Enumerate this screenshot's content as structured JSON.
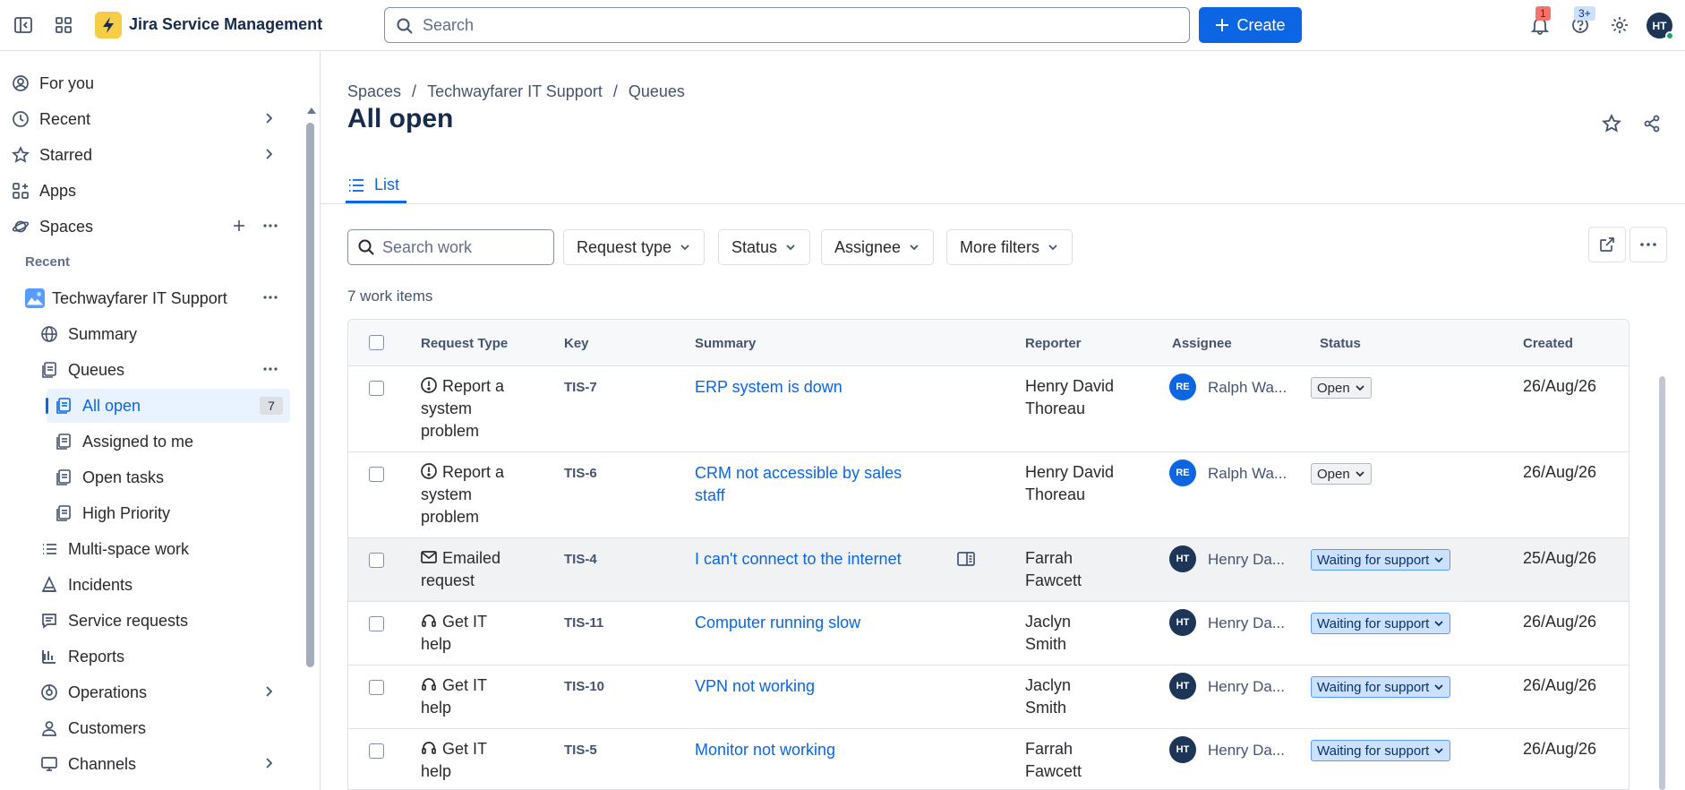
{
  "app": {
    "name": "Jira Service Management"
  },
  "topbar": {
    "search_placeholder": "Search",
    "create_label": "Create",
    "notifications_badge": "1",
    "help_badge": "3+",
    "user_initials": "HT"
  },
  "sidebar": {
    "items": [
      {
        "label": "For you",
        "icon": "user-circle-icon"
      },
      {
        "label": "Recent",
        "icon": "clock-icon"
      },
      {
        "label": "Starred",
        "icon": "star-icon"
      },
      {
        "label": "Apps",
        "icon": "apps-icon"
      },
      {
        "label": "Spaces",
        "icon": "planet-icon"
      }
    ],
    "recent_label": "Recent",
    "space": {
      "name": "Techwayfarer IT Support",
      "items": [
        {
          "label": "Summary",
          "icon": "globe-icon"
        },
        {
          "label": "Queues",
          "icon": "queue-icon"
        }
      ],
      "queues": [
        {
          "label": "All open",
          "count": "7"
        },
        {
          "label": "Assigned to me"
        },
        {
          "label": "Open tasks"
        },
        {
          "label": "High Priority"
        }
      ],
      "more": [
        {
          "label": "Multi-space work",
          "icon": "list-icon"
        },
        {
          "label": "Incidents",
          "icon": "incident-icon"
        },
        {
          "label": "Service requests",
          "icon": "request-icon"
        },
        {
          "label": "Reports",
          "icon": "chart-icon"
        },
        {
          "label": "Operations",
          "icon": "operations-icon"
        },
        {
          "label": "Customers",
          "icon": "person-icon"
        },
        {
          "label": "Channels",
          "icon": "monitor-icon"
        }
      ]
    }
  },
  "breadcrumb": [
    "Spaces",
    "Techwayfarer IT Support",
    "Queues"
  ],
  "page_title": "All open",
  "tab": {
    "label": "List"
  },
  "filters": {
    "search_placeholder": "Search work",
    "request_type": "Request type",
    "status": "Status",
    "assignee": "Assignee",
    "more": "More filters"
  },
  "work_count": "7 work items",
  "table": {
    "headers": [
      "Request Type",
      "Key",
      "Summary",
      "Reporter",
      "Assignee",
      "Status",
      "Created"
    ],
    "rows": [
      {
        "rt1": "Report a",
        "rt2": "system",
        "rt3": "problem",
        "rt_icon": "alert-icon",
        "key": "TIS-7",
        "sum1": "ERP system is down",
        "sum2": "",
        "rep1": "Henry David",
        "rep2": "Thoreau",
        "av": "RE",
        "assignee": "Ralph Wa...",
        "status": "Open",
        "created": "26/Aug/26"
      },
      {
        "rt1": "Report a",
        "rt2": "system",
        "rt3": "problem",
        "rt_icon": "alert-icon",
        "key": "TIS-6",
        "sum1": "CRM not accessible by sales",
        "sum2": "staff",
        "rep1": "Henry David",
        "rep2": "Thoreau",
        "av": "RE",
        "assignee": "Ralph Wa...",
        "status": "Open",
        "created": "26/Aug/26"
      },
      {
        "rt1": "Emailed",
        "rt2": "request",
        "rt3": "",
        "rt_icon": "mail-icon",
        "key": "TIS-4",
        "sum1": "I can't connect to the internet",
        "sum2": "",
        "rep1": "Farrah",
        "rep2": "Fawcett",
        "av": "HT",
        "assignee": "Henry Da...",
        "status": "Waiting for support",
        "created": "25/Aug/26"
      },
      {
        "rt1": "Get IT",
        "rt2": "help",
        "rt3": "",
        "rt_icon": "headset-icon",
        "key": "TIS-11",
        "sum1": "Computer running slow",
        "sum2": "",
        "rep1": "Jaclyn",
        "rep2": "Smith",
        "av": "HT",
        "assignee": "Henry Da...",
        "status": "Waiting for support",
        "created": "26/Aug/26"
      },
      {
        "rt1": "Get IT",
        "rt2": "help",
        "rt3": "",
        "rt_icon": "headset-icon",
        "key": "TIS-10",
        "sum1": "VPN not working",
        "sum2": "",
        "rep1": "Jaclyn",
        "rep2": "Smith",
        "av": "HT",
        "assignee": "Henry Da...",
        "status": "Waiting for support",
        "created": "26/Aug/26"
      },
      {
        "rt1": "Get IT",
        "rt2": "help",
        "rt3": "",
        "rt_icon": "headset-icon",
        "key": "TIS-5",
        "sum1": "Monitor not working",
        "sum2": "",
        "rep1": "Farrah",
        "rep2": "Fawcett",
        "av": "HT",
        "assignee": "Henry Da...",
        "status": "Waiting for support",
        "created": "26/Aug/26"
      }
    ]
  },
  "colors": {
    "accent": "#0c66e4",
    "logo": "#f5cd47",
    "status_wait_bg": "#cce0ff"
  }
}
